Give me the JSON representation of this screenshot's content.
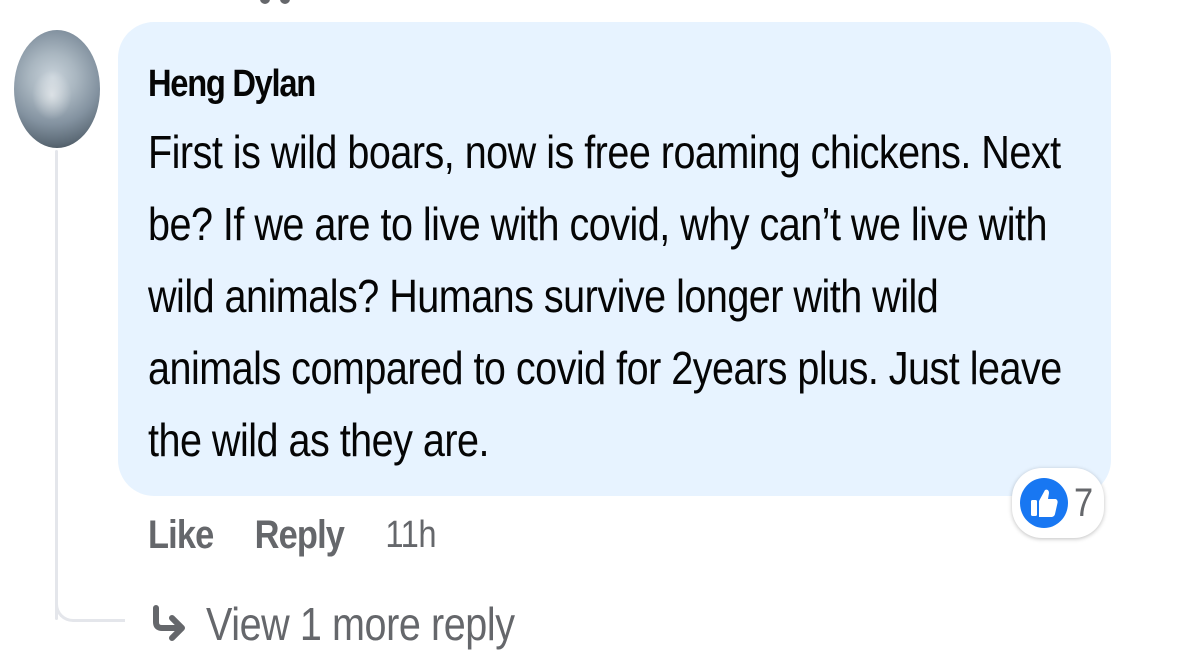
{
  "comment": {
    "author": "Heng Dylan",
    "lines": [
      "First is wild boars, now is free roaming chickens. Next",
      "be? If we are to live with covid, why can’t we live with",
      "wild animals? Humans survive longer with wild",
      "animals compared to covid for 2years plus. Just leave",
      "the wild as they are."
    ],
    "reaction_icon": "like-thumbs-up-icon",
    "reaction_count": "7",
    "like_label": "Like",
    "reply_label": "Reply",
    "timestamp": "11h",
    "view_more_label": "View 1 more reply"
  },
  "colors": {
    "bubble": "#e7f3ff",
    "accent": "#1877f2",
    "secondary_text": "#65676b",
    "thread_line": "#e4e6eb"
  }
}
